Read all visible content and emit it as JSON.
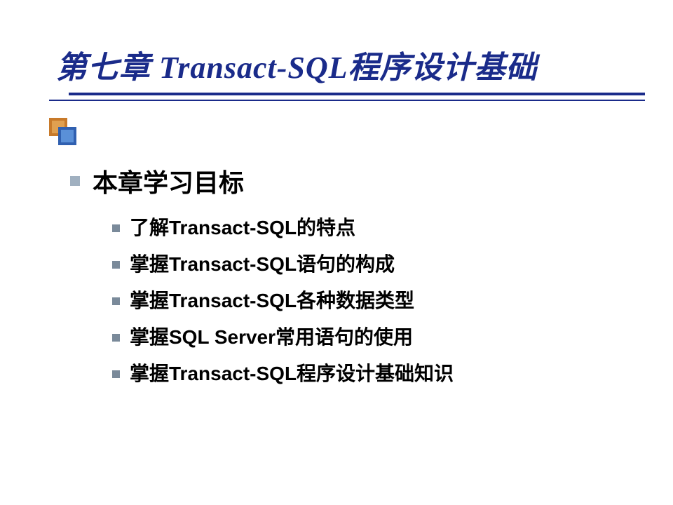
{
  "title": "第七章 Transact-SQL程序设计基础",
  "section_heading": "本章学习目标",
  "objectives": {
    "item0": "了解Transact-SQL的特点",
    "item1": "掌握Transact-SQL语句的构成",
    "item2": "掌握Transact-SQL各种数据类型",
    "item3": "掌握SQL Server常用语句的使用",
    "item4": "掌握Transact-SQL程序设计基础知识"
  }
}
